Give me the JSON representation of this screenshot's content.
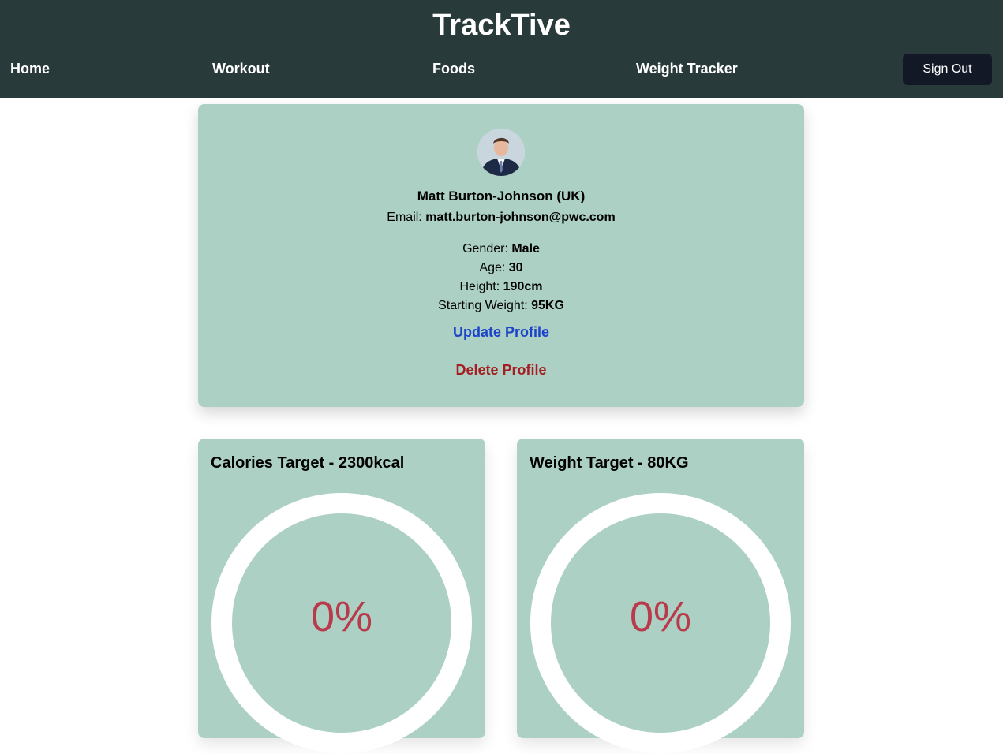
{
  "header": {
    "brand": "TrackTive",
    "nav": {
      "home": "Home",
      "workout": "Workout",
      "foods": "Foods",
      "weight_tracker": "Weight Tracker"
    },
    "sign_out": "Sign Out"
  },
  "profile": {
    "name": "Matt Burton-Johnson (UK)",
    "email_label": "Email:",
    "email": "matt.burton-johnson@pwc.com",
    "gender_label": "Gender:",
    "gender": "Male",
    "age_label": "Age:",
    "age": "30",
    "height_label": "Height:",
    "height": "190cm",
    "starting_weight_label": "Starting Weight:",
    "starting_weight": "95KG",
    "update_label": "Update Profile",
    "delete_label": "Delete Profile"
  },
  "targets": {
    "calories": {
      "title": "Calories Target - 2300kcal",
      "percent_label": "0%",
      "progress": 0
    },
    "weight": {
      "title": "Weight Target - 80KG",
      "percent_label": "0%",
      "progress": 0
    }
  },
  "colors": {
    "header_bg": "#283b3a",
    "card_bg": "#acd0c4",
    "update_link": "#1d44c8",
    "delete_link": "#a41e22",
    "percent_text": "#b83a4b",
    "signout_bg": "#121826"
  }
}
